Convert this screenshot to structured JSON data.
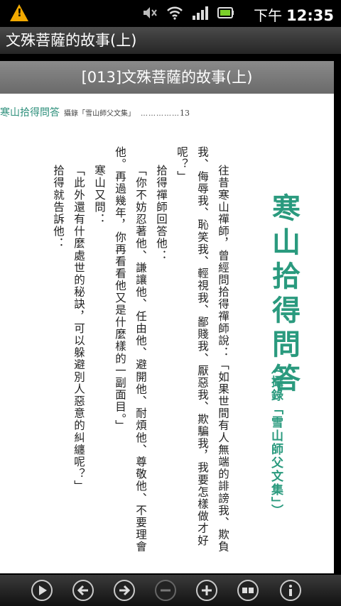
{
  "status_bar": {
    "ampm": "下午",
    "time": "12:35",
    "icons": [
      "warning-icon",
      "mute-icon",
      "wifi-icon",
      "signal-icon",
      "battery-icon"
    ]
  },
  "title_bar": {
    "title": "文殊菩薩的故事(上)"
  },
  "page_banner": {
    "title": "[013]文殊菩薩的故事(上)"
  },
  "book_page": {
    "header_title": "寒山拾得問答",
    "header_sub": "攝錄「雪山師父文集」",
    "header_dots": "……………",
    "page_number": "13",
    "big_title": "寒山拾得問答",
    "sub_title": "（攝錄「雪山師父文集」）",
    "columns": [
      "往昔寒山禪師，曾經問拾得禪師說：「如果世間有人無端的誹謗我、欺負",
      "我、侮辱我、恥笑我、輕視我、鄙賤我、厭惡我、欺騙我，我要怎樣做才好",
      "呢？」",
      "拾得禪師回答他：",
      "「你不妨忍著他、謙讓他、任由他、避開他、耐煩他、尊敬他、不要理會",
      "他。再過幾年，你再看看他又是什麼樣的一副面目。」",
      "寒山又問：",
      "「此外還有什麼處世的秘訣，可以躲避別人惡意的糾纏呢？」",
      "拾得就告訴他："
    ]
  },
  "toolbar": {
    "buttons": [
      "play-icon",
      "previous-icon",
      "next-icon",
      "zoom-out-icon",
      "zoom-in-icon",
      "fit-page-icon",
      "info-icon"
    ]
  }
}
